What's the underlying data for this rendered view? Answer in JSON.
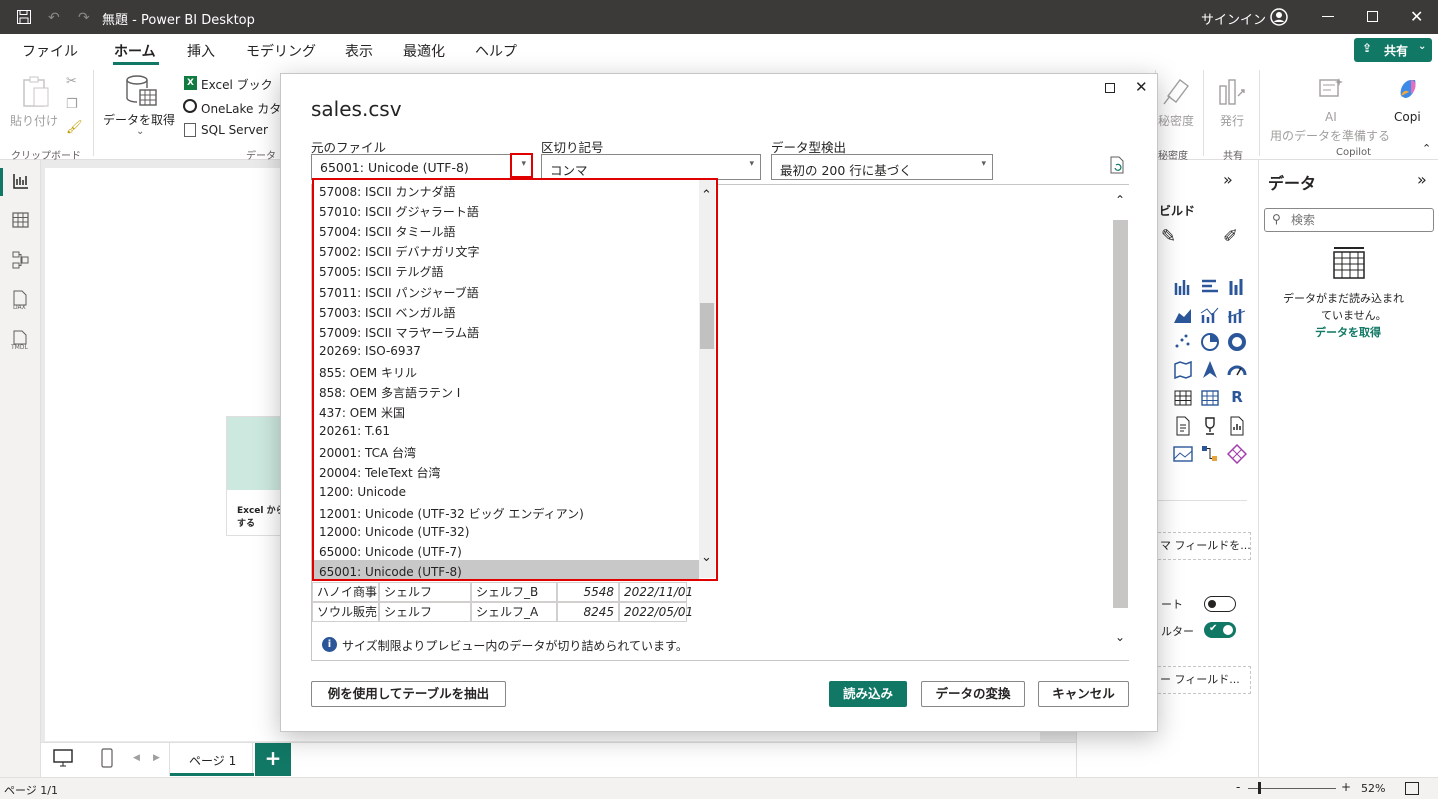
{
  "window": {
    "title": "無題 - Power BI Desktop",
    "signin": "サインイン"
  },
  "menu": {
    "tabs": [
      "ファイル",
      "ホーム",
      "挿入",
      "モデリング",
      "表示",
      "最適化",
      "ヘルプ"
    ],
    "active": "ホーム",
    "share": "共有"
  },
  "ribbon": {
    "paste": "貼り付け",
    "clipboard_group": "クリップボード",
    "get_data": "データを取得",
    "excel": "Excel ブック",
    "onelake": "OneLake カタロ",
    "sql": "SQL Server",
    "data_group": "データ",
    "sensitivity": "秘密度",
    "sensitivity_group": "秘密度",
    "publish": "発行",
    "share_group": "共有",
    "ai_line1": "AI",
    "ai_line2": "用のデータを準備する",
    "copilot": "Copi",
    "copilot_group": "Copilot"
  },
  "dialog": {
    "title": "sales.csv",
    "origin_label": "元のファイル",
    "origin_value": "65001: Unicode (UTF-8)",
    "delimiter_label": "区切り記号",
    "delimiter_value": "コンマ",
    "detect_label": "データ型検出",
    "detect_value": "最初の 200 行に基づく",
    "encoding_options": [
      "57008: ISCII カンナダ語",
      "57010: ISCII グジャラート語",
      "57004: ISCII タミール語",
      "57002: ISCII デバナガリ文字",
      "57005: ISCII テルグ語",
      "57011: ISCII パンジャーブ語",
      "57003: ISCII ベンガル語",
      "57009: ISCII マラヤーラム語",
      "20269: ISO-6937",
      "855: OEM キリル",
      "858: OEM 多言語ラテン I",
      "437: OEM 米国",
      "20261: T.61",
      "20001: TCA 台湾",
      "20004: TeleText 台湾",
      "1200: Unicode",
      "12001: Unicode (UTF-32 ビッグ エンディアン)",
      "12000: Unicode (UTF-32)",
      "65000: Unicode (UTF-7)",
      "65001: Unicode (UTF-8)"
    ],
    "rows": [
      [
        "ハノイ商事",
        "シェルフ",
        "シェルフ_B",
        "5548",
        "2022/11/01"
      ],
      [
        "ソウル販売",
        "シェルフ",
        "シェルフ_A",
        "8245",
        "2022/05/01"
      ]
    ],
    "info": "サイズ制限よりプレビュー内のデータが切り詰められています。",
    "extract_btn": "例を使用してテーブルを抽出",
    "load_btn": "読み込み",
    "transform_btn": "データの変換",
    "cancel_btn": "キャンセル"
  },
  "canvas": {
    "card_text_1": "Excel から",
    "card_text_2": "する"
  },
  "viz_pane": {
    "build": "ビルド",
    "field_well": "マ フィールドを...",
    "toggle1": "ート",
    "toggle2": "ルター",
    "drill": "ー フィールド..."
  },
  "data_pane": {
    "title": "データ",
    "search_placeholder": "検索",
    "empty1": "データがまだ読み込まれ",
    "empty2": "ていません。",
    "get_data_link": "データを取得"
  },
  "pages": {
    "tab": "ページ 1"
  },
  "status": {
    "page": "ページ 1/1",
    "zoom": "52%"
  }
}
